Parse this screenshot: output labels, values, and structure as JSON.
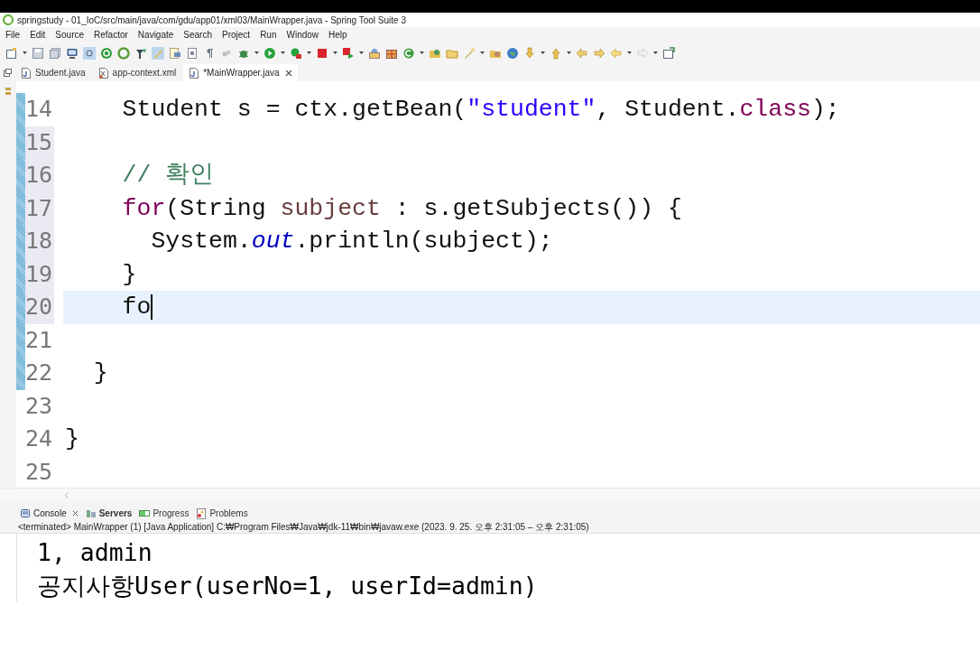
{
  "window": {
    "title": "springstudy - 01_IoC/src/main/java/com/gdu/app01/xml03/MainWrapper.java - Spring Tool Suite 3"
  },
  "menu": [
    "File",
    "Edit",
    "Source",
    "Refactor",
    "Navigate",
    "Search",
    "Project",
    "Run",
    "Window",
    "Help"
  ],
  "editor_tabs": [
    {
      "label": "Student.java",
      "kind": "java",
      "selected": false
    },
    {
      "label": "app-context.xml",
      "kind": "xml",
      "selected": false
    },
    {
      "label": "*MainWrapper.java",
      "kind": "java",
      "selected": true
    }
  ],
  "code_lines": [
    {
      "number": "14",
      "changed": true,
      "marked": false,
      "current": false,
      "tokens": [
        {
          "kind": "plain",
          "text": "    Student s = ctx.getBean("
        },
        {
          "kind": "string",
          "text": "\"student\""
        },
        {
          "kind": "plain",
          "text": ", Student."
        },
        {
          "kind": "keyword",
          "text": "class"
        },
        {
          "kind": "plain",
          "text": ");"
        }
      ]
    },
    {
      "number": "15",
      "changed": true,
      "marked": true,
      "current": false
    },
    {
      "number": "16",
      "changed": true,
      "marked": true,
      "current": false,
      "tokens": [
        {
          "kind": "comment",
          "text": "    // 확인"
        }
      ]
    },
    {
      "number": "17",
      "changed": true,
      "marked": true,
      "current": false,
      "tokens": [
        {
          "kind": "keyword",
          "text": "    for"
        },
        {
          "kind": "plain",
          "text": "(String "
        },
        {
          "kind": "local",
          "text": "subject"
        },
        {
          "kind": "plain",
          "text": " : s.getSubjects()) {"
        }
      ]
    },
    {
      "number": "18",
      "changed": true,
      "marked": true,
      "current": false,
      "tokens": [
        {
          "kind": "plain",
          "text": "      System."
        },
        {
          "kind": "field",
          "text": "out"
        },
        {
          "kind": "plain",
          "text": ".println(subject);"
        }
      ]
    },
    {
      "number": "19",
      "changed": true,
      "marked": true,
      "current": false,
      "tokens": [
        {
          "kind": "plain",
          "text": "    }"
        }
      ]
    },
    {
      "number": "20",
      "changed": true,
      "marked": true,
      "current": true,
      "tokens": [
        {
          "kind": "plain",
          "text": "    fo"
        }
      ]
    },
    {
      "number": "21",
      "changed": true,
      "marked": false,
      "current": false
    },
    {
      "number": "22",
      "changed": true,
      "marked": false,
      "current": false,
      "tokens": [
        {
          "kind": "plain",
          "text": "  }"
        }
      ]
    },
    {
      "number": "23",
      "changed": false,
      "marked": false,
      "current": false
    },
    {
      "number": "24",
      "changed": false,
      "marked": false,
      "current": false,
      "tokens": [
        {
          "kind": "plain",
          "text": "}"
        }
      ]
    },
    {
      "number": "25",
      "changed": false,
      "marked": false,
      "current": false
    }
  ],
  "console": {
    "tabs": [
      {
        "label": "Console",
        "kind": "console",
        "selected": true,
        "emphasized": false
      },
      {
        "label": "Servers",
        "kind": "servers",
        "selected": false,
        "emphasized": true
      },
      {
        "label": "Progress",
        "kind": "progress",
        "selected": false,
        "emphasized": false
      },
      {
        "label": "Problems",
        "kind": "problems",
        "selected": false,
        "emphasized": false
      }
    ],
    "status": "<terminated> MainWrapper (1) [Java Application] C:₩Program Files₩Java₩jdk-11₩bin₩javaw.exe  (2023. 9. 25. 오후 2:31:05 – 오후 2:31:05)",
    "output": [
      "1, admin",
      "공지사항User(userNo=1, userId=admin)"
    ]
  }
}
